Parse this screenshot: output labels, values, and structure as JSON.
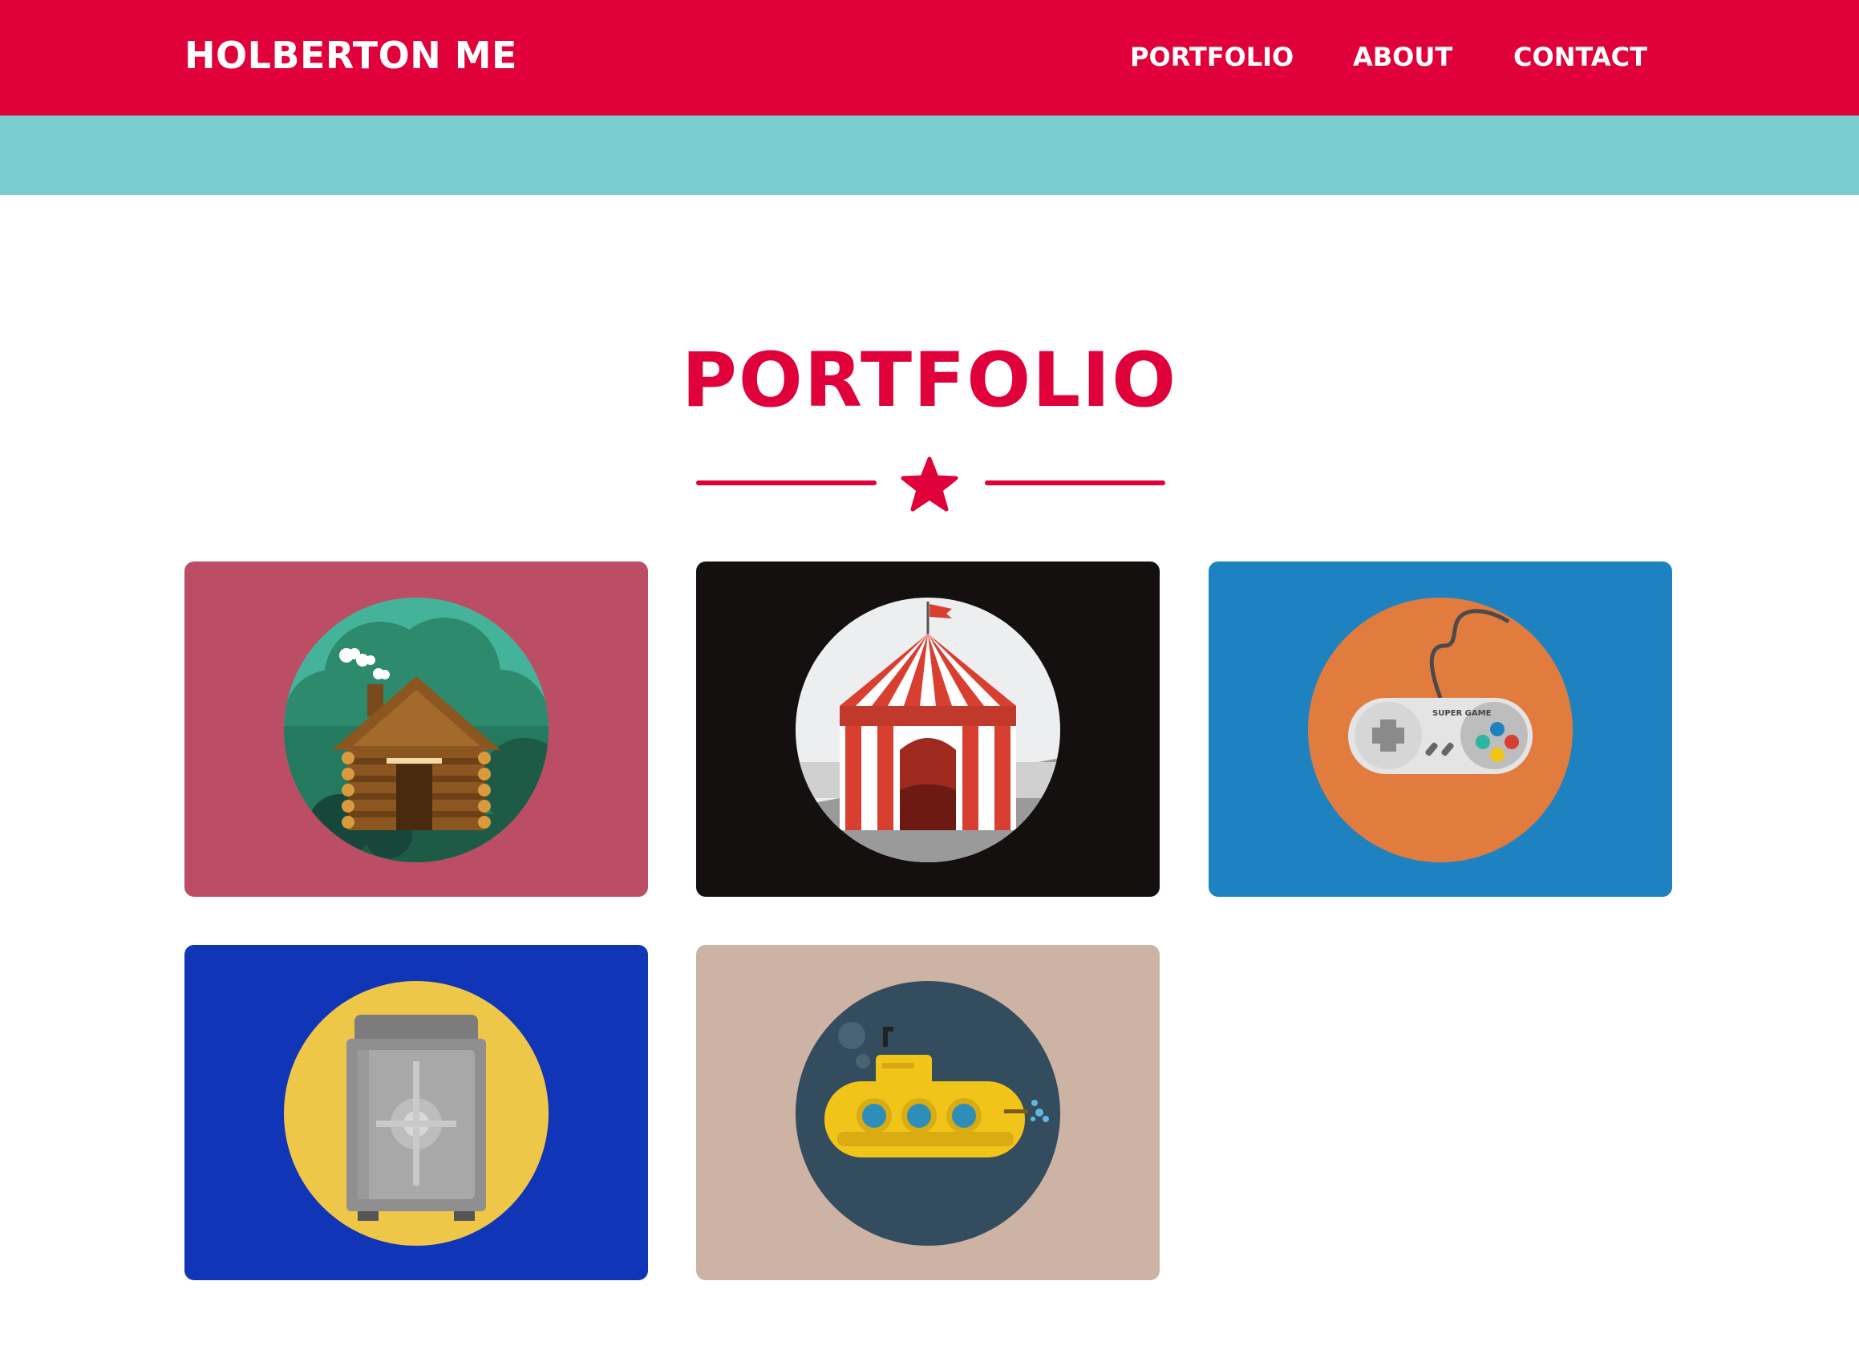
{
  "header": {
    "brand": "HOLBERTON ME",
    "nav": [
      {
        "label": "PORTFOLIO"
      },
      {
        "label": "ABOUT"
      },
      {
        "label": "CONTACT"
      }
    ]
  },
  "portfolio": {
    "title": "PORTFOLIO",
    "items": [
      {
        "icon": "log-cabin-icon",
        "bg_color": "#bb4e65",
        "disc_color": "#45b39a"
      },
      {
        "icon": "circus-tent-icon",
        "bg_color": "#141010",
        "disc_color": "#eceeef"
      },
      {
        "icon": "game-controller-icon",
        "bg_color": "#1e82c1",
        "disc_color": "#e27c3e",
        "controller_text": "SUPER GAME"
      },
      {
        "icon": "safe-icon",
        "bg_color": "#1035b7",
        "disc_color": "#eec648"
      },
      {
        "icon": "submarine-icon",
        "bg_color": "#cdb3a4",
        "disc_color": "#344d5e"
      }
    ]
  },
  "colors": {
    "primary": "#e0003a",
    "band": "#79cdd1",
    "background": "#ffffff"
  }
}
